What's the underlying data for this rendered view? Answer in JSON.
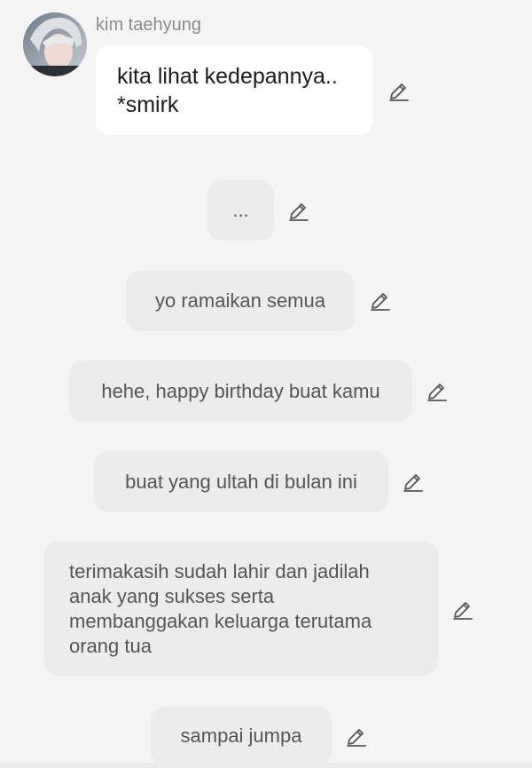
{
  "chat": {
    "sender_name": "kim taehyung",
    "messages": [
      {
        "text": "kita lihat kedepannya.. *smirk"
      },
      {
        "text": "..."
      },
      {
        "text": "yo ramaikan semua"
      },
      {
        "text": "hehe, happy birthday buat kamu"
      },
      {
        "text": "buat yang ultah di bulan ini"
      },
      {
        "text": "terimakasih sudah lahir dan jadilah anak yang sukses serta membanggakan keluarga terutama orang tua"
      },
      {
        "text": "sampai jumpa"
      }
    ]
  },
  "icons": {
    "avatar": "profile-photo",
    "edit": "pencil-edit-icon"
  },
  "colors": {
    "background": "#f5f5f5",
    "own_bubble": "#ffffff",
    "other_bubble": "#ececec",
    "name_text": "#8a8a8a"
  }
}
